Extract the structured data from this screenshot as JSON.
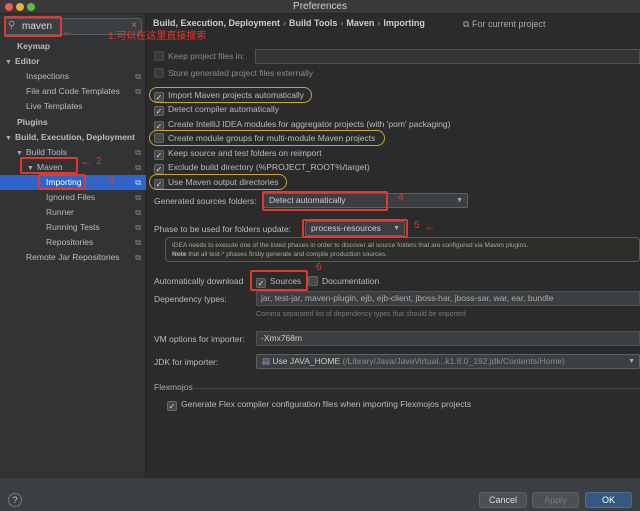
{
  "window": {
    "title": "Preferences"
  },
  "search": {
    "value": "maven",
    "search_icon": "magnifier-icon",
    "clear_icon": "clear-icon"
  },
  "sidebar": {
    "items": [
      {
        "label": "Keymap"
      },
      {
        "label": "Editor"
      },
      {
        "label": "Inspections"
      },
      {
        "label": "File and Code Templates"
      },
      {
        "label": "Live Templates"
      },
      {
        "label": "Plugins"
      },
      {
        "label": "Build, Execution, Deployment"
      },
      {
        "label": "Build Tools"
      },
      {
        "label": "Maven"
      },
      {
        "label": "Importing"
      },
      {
        "label": "Ignored Files"
      },
      {
        "label": "Runner"
      },
      {
        "label": "Running Tests"
      },
      {
        "label": "Repositories"
      },
      {
        "label": "Remote Jar Repositories"
      }
    ]
  },
  "annotations": {
    "a1": "1.可以在这里直接搜索",
    "a2": "2",
    "a3": "3",
    "a4": "4",
    "a5": "5",
    "a6": "6"
  },
  "breadcrumb": [
    "Build, Execution, Deployment",
    "Build Tools",
    "Maven",
    "Importing"
  ],
  "for_current_project": "For current project",
  "options": {
    "keep_files_in": "Keep project files in:",
    "store_externally": "Store generated project files externally",
    "import_auto": "Import Maven projects automatically",
    "detect_compiler": "Detect compiler automatically",
    "create_intellij_modules": "Create IntelliJ IDEA modules for aggregator projects (with 'pom' packaging)",
    "create_module_groups": "Create module groups for multi-module Maven projects",
    "keep_source_folders": "Keep source and test folders on reimport",
    "exclude_build_dir": "Exclude build directory (%PROJECT_ROOT%/target)",
    "use_output_dirs": "Use Maven output directories"
  },
  "generated_sources": {
    "label": "Generated sources folders:",
    "value": "Detect automatically"
  },
  "phase": {
    "label": "Phase to be used for folders update:",
    "value": "process-resources"
  },
  "info": {
    "line1": "IDEA needs to execute one of the listed phases in order to discover all source folders that are configured via Maven plugins.",
    "note_bold": "Note",
    "line2": " that all test-* phases firstly generate and compile production sources."
  },
  "auto_download": {
    "label": "Automatically download",
    "sources": "Sources",
    "documentation": "Documentation"
  },
  "dependency_types": {
    "label": "Dependency types:",
    "value": "jar, test-jar, maven-plugin, ejb, ejb-client, jboss-har, jboss-sar, war, ear, bundle",
    "hint": "Comma separated list of dependency types that should be imported"
  },
  "vm_options": {
    "label": "VM options for importer:",
    "value": "-Xmx768m"
  },
  "jdk": {
    "label": "JDK for importer:",
    "value": "Use JAVA_HOME",
    "path": "(/Library/Java/JavaVirtual...k1.8.0_192.jdk/Contents/Home)"
  },
  "flexmojos": {
    "title": "Flexmojos",
    "generate": "Generate Flex compiler configuration files when importing Flexmojos projects"
  },
  "buttons": {
    "help": "?",
    "cancel": "Cancel",
    "apply": "Apply",
    "ok": "OK"
  }
}
